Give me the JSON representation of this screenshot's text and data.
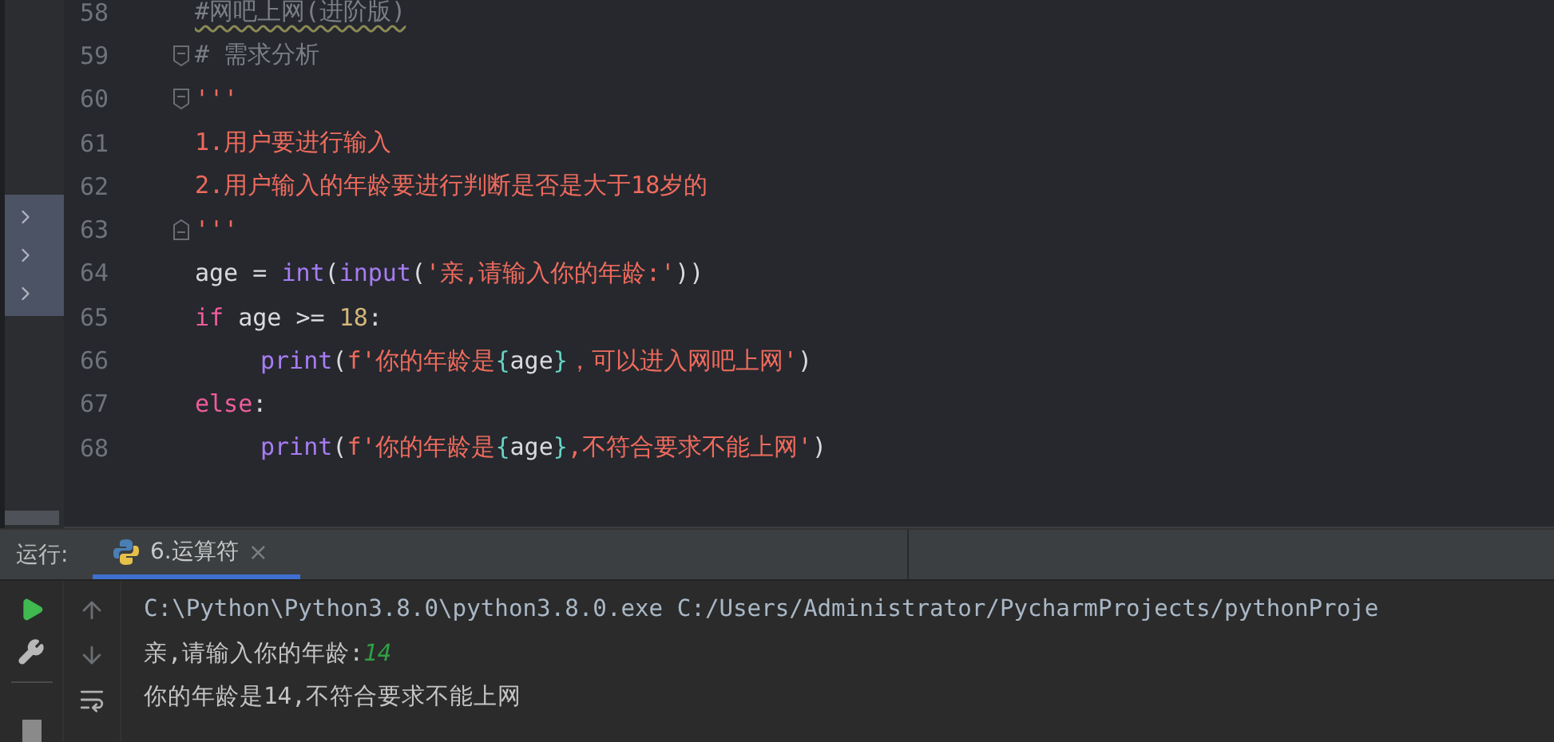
{
  "editor": {
    "lines": [
      {
        "number": "58",
        "fold_start": false,
        "fold_end": false,
        "indent": false,
        "tokens": [
          {
            "kind": "comment_warn",
            "text": "#网吧上网(进阶版)"
          }
        ]
      },
      {
        "number": "59",
        "fold_start": true,
        "fold_end": false,
        "indent": false,
        "tokens": [
          {
            "kind": "comment",
            "text": "# 需求分析"
          }
        ]
      },
      {
        "number": "60",
        "fold_start": true,
        "fold_end": false,
        "indent": false,
        "tokens": [
          {
            "kind": "string",
            "text": "'''"
          }
        ]
      },
      {
        "number": "61",
        "fold_start": false,
        "fold_end": false,
        "indent": false,
        "tokens": [
          {
            "kind": "string",
            "text": "1.用户要进行输入"
          }
        ]
      },
      {
        "number": "62",
        "fold_start": false,
        "fold_end": false,
        "indent": false,
        "tokens": [
          {
            "kind": "string",
            "text": "2.用户输入的年龄要进行判断是否是大于18岁的"
          }
        ]
      },
      {
        "number": "63",
        "fold_start": false,
        "fold_end": true,
        "indent": false,
        "tokens": [
          {
            "kind": "string",
            "text": "'''"
          }
        ]
      },
      {
        "number": "64",
        "fold_start": false,
        "fold_end": false,
        "indent": false,
        "tokens": [
          {
            "kind": "plain",
            "text": "age = "
          },
          {
            "kind": "builtin",
            "text": "int"
          },
          {
            "kind": "plain",
            "text": "("
          },
          {
            "kind": "builtin",
            "text": "input"
          },
          {
            "kind": "plain",
            "text": "("
          },
          {
            "kind": "string",
            "text": "'亲,请输入你的年龄:'"
          },
          {
            "kind": "plain",
            "text": "))"
          }
        ]
      },
      {
        "number": "65",
        "fold_start": false,
        "fold_end": false,
        "indent": false,
        "tokens": [
          {
            "kind": "keyword",
            "text": "if"
          },
          {
            "kind": "plain",
            "text": " age >= "
          },
          {
            "kind": "number",
            "text": "18"
          },
          {
            "kind": "plain",
            "text": ":"
          }
        ]
      },
      {
        "number": "66",
        "fold_start": false,
        "fold_end": false,
        "indent": true,
        "tokens": [
          {
            "kind": "builtin",
            "text": "print"
          },
          {
            "kind": "plain",
            "text": "("
          },
          {
            "kind": "string",
            "text": "f'你的年龄是"
          },
          {
            "kind": "brace",
            "text": "{"
          },
          {
            "kind": "plain",
            "text": "age"
          },
          {
            "kind": "brace",
            "text": "}"
          },
          {
            "kind": "string",
            "text": "，可以进入网吧上网'"
          },
          {
            "kind": "plain",
            "text": ")"
          }
        ]
      },
      {
        "number": "67",
        "fold_start": false,
        "fold_end": false,
        "indent": false,
        "tokens": [
          {
            "kind": "keyword",
            "text": "else"
          },
          {
            "kind": "plain",
            "text": ":"
          }
        ]
      },
      {
        "number": "68",
        "fold_start": false,
        "fold_end": false,
        "indent": true,
        "tokens": [
          {
            "kind": "builtin",
            "text": "print"
          },
          {
            "kind": "plain",
            "text": "("
          },
          {
            "kind": "string",
            "text": "f'你的年龄是"
          },
          {
            "kind": "brace",
            "text": "{"
          },
          {
            "kind": "plain",
            "text": "age"
          },
          {
            "kind": "brace",
            "text": "}"
          },
          {
            "kind": "string",
            "text": ",不符合要求不能上网'"
          },
          {
            "kind": "plain",
            "text": ")"
          }
        ]
      }
    ]
  },
  "run_panel": {
    "label": "运行:",
    "tabs": [
      {
        "label": "6.运算符",
        "selected": true,
        "close": "×"
      }
    ],
    "console": [
      {
        "segments": [
          {
            "kind": "command",
            "text": "C:\\Python\\Python3.8.0\\python3.8.0.exe C:/Users/Administrator/PycharmProjects/pythonProje"
          }
        ]
      },
      {
        "segments": [
          {
            "kind": "output",
            "text": "亲,请输入你的年龄:"
          },
          {
            "kind": "input",
            "text": "14"
          }
        ]
      },
      {
        "segments": [
          {
            "kind": "output",
            "text": "你的年龄是14,不符合要求不能上网"
          }
        ]
      }
    ]
  }
}
